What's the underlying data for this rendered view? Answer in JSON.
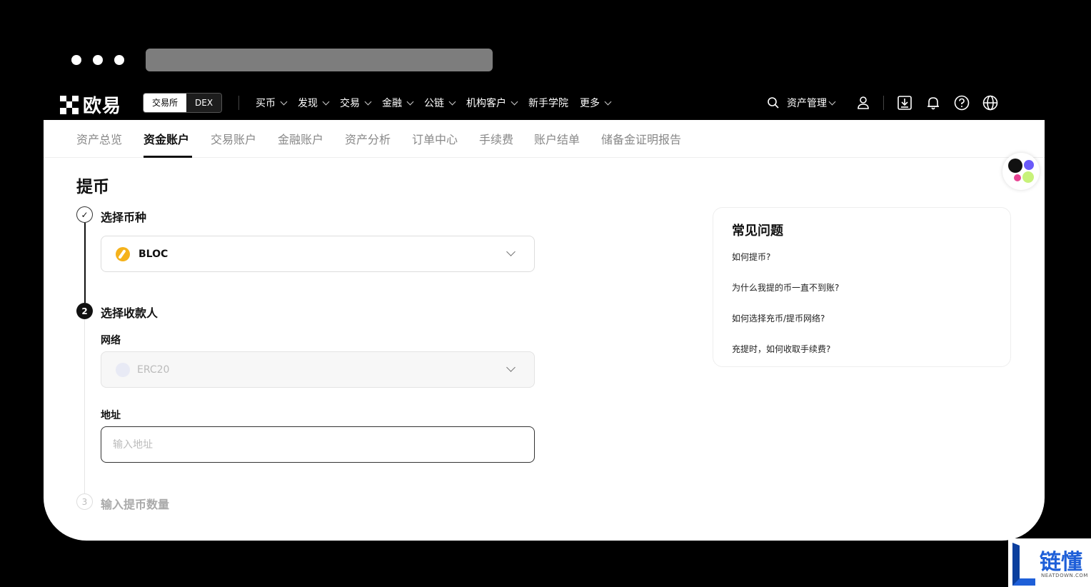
{
  "header": {
    "logo_text": "欧易",
    "switch": {
      "exchange": "交易所",
      "dex": "DEX"
    },
    "menu": [
      {
        "label": "买币",
        "dropdown": true
      },
      {
        "label": "发现",
        "dropdown": true
      },
      {
        "label": "交易",
        "dropdown": true
      },
      {
        "label": "金融",
        "dropdown": true
      },
      {
        "label": "公链",
        "dropdown": true
      },
      {
        "label": "机构客户",
        "dropdown": true
      },
      {
        "label": "新手学院",
        "dropdown": false
      },
      {
        "label": "更多",
        "dropdown": true
      }
    ],
    "asset_management": "资产管理"
  },
  "subnav": {
    "tabs": [
      "资产总览",
      "资金账户",
      "交易账户",
      "金融账户",
      "资产分析",
      "订单中心",
      "手续费",
      "账户结单",
      "储备金证明报告"
    ],
    "active": "资金账户"
  },
  "page": {
    "title": "提币",
    "step1": {
      "number": "✓",
      "label": "选择币种",
      "coin": "BLOC"
    },
    "step2": {
      "number": "2",
      "label": "选择收款人",
      "network_label": "网络",
      "network_value": "ERC20",
      "address_label": "地址",
      "address_placeholder": "输入地址"
    },
    "step3": {
      "number": "3",
      "label": "输入提币数量"
    }
  },
  "faq": {
    "title": "常见问题",
    "items": [
      "如何提币?",
      "为什么我提的币一直不到账?",
      "如何选择充币/提币网络?",
      "充提时，如何收取手续费?"
    ]
  },
  "brand": {
    "name": "链懂",
    "sub": "NEATDOWN.COM"
  },
  "colors": {
    "accent": "#111111",
    "coin": "#f5b21b",
    "brand": "#1e5fd8"
  }
}
